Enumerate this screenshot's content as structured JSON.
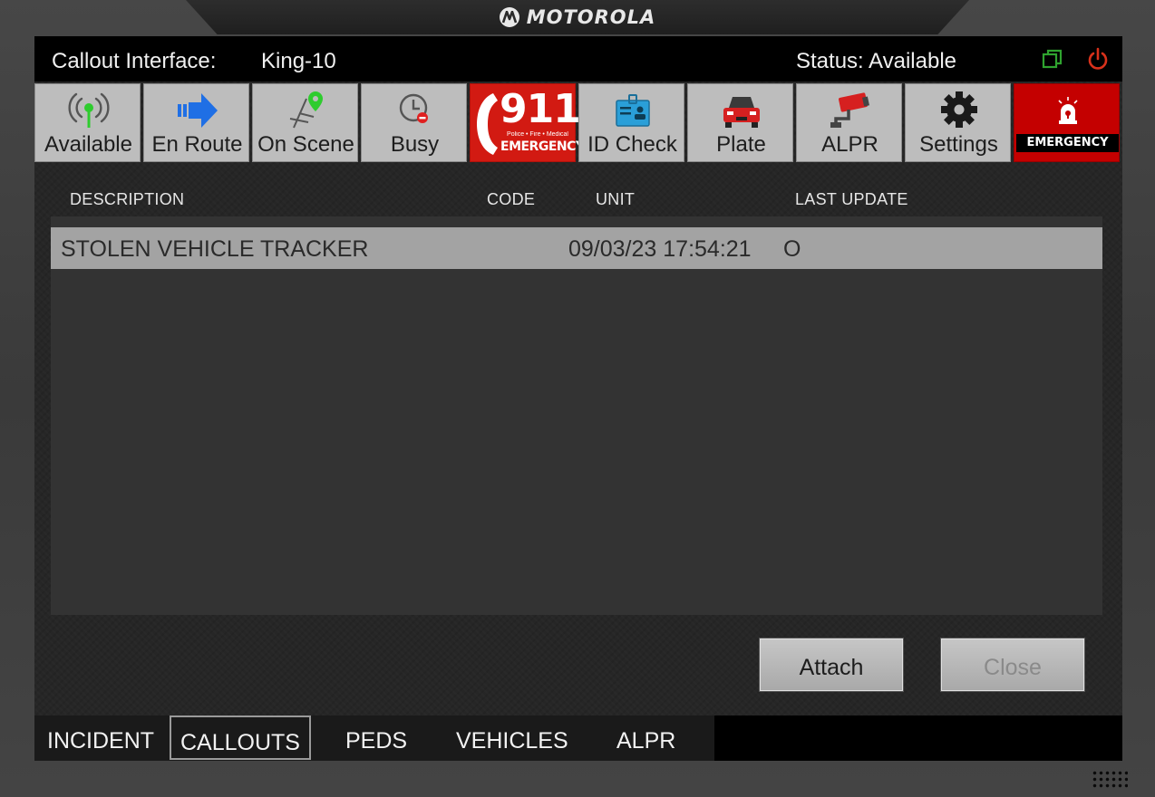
{
  "brand": {
    "name": "MOTOROLA",
    "logo_icon": "motorola-m-icon"
  },
  "titlebar": {
    "label": "Callout Interface:",
    "unit": "King-10",
    "status": "Status: Available",
    "copy_icon": "window-copy-icon",
    "power_icon": "power-icon",
    "colors": {
      "copy": "#2fa32f",
      "power": "#d8311b"
    }
  },
  "toolbar": {
    "available": "Available",
    "en_route": "En Route",
    "on_scene": "On Scene",
    "busy": "Busy",
    "e911_number": "911",
    "e911_sub": "Police • Fire • Medical",
    "e911_word": "EMERGENCY",
    "id_check": "ID Check",
    "plate": "Plate",
    "alpr": "ALPR",
    "settings": "Settings",
    "emergency": "EMERGENCY"
  },
  "table": {
    "headers": {
      "description": "DESCRIPTION",
      "code": "CODE",
      "unit": "UNIT",
      "last_update": "LAST UPDATE"
    },
    "rows": [
      {
        "description": "STOLEN VEHICLE TRACKER",
        "timestamp": "09/03/23 17:54:21",
        "code": "O"
      }
    ]
  },
  "actions": {
    "attach": "Attach",
    "close": "Close"
  },
  "tabs": {
    "incident": "INCIDENT",
    "callouts": "CALLOUTS",
    "peds": "PEDS",
    "vehicles": "VEHICLES",
    "alpr": "ALPR",
    "active": "CALLOUTS"
  },
  "colors": {
    "accent_red": "#d21a12",
    "row_selected": "#a3a3a3",
    "button_gray": "#bdbdbd"
  }
}
